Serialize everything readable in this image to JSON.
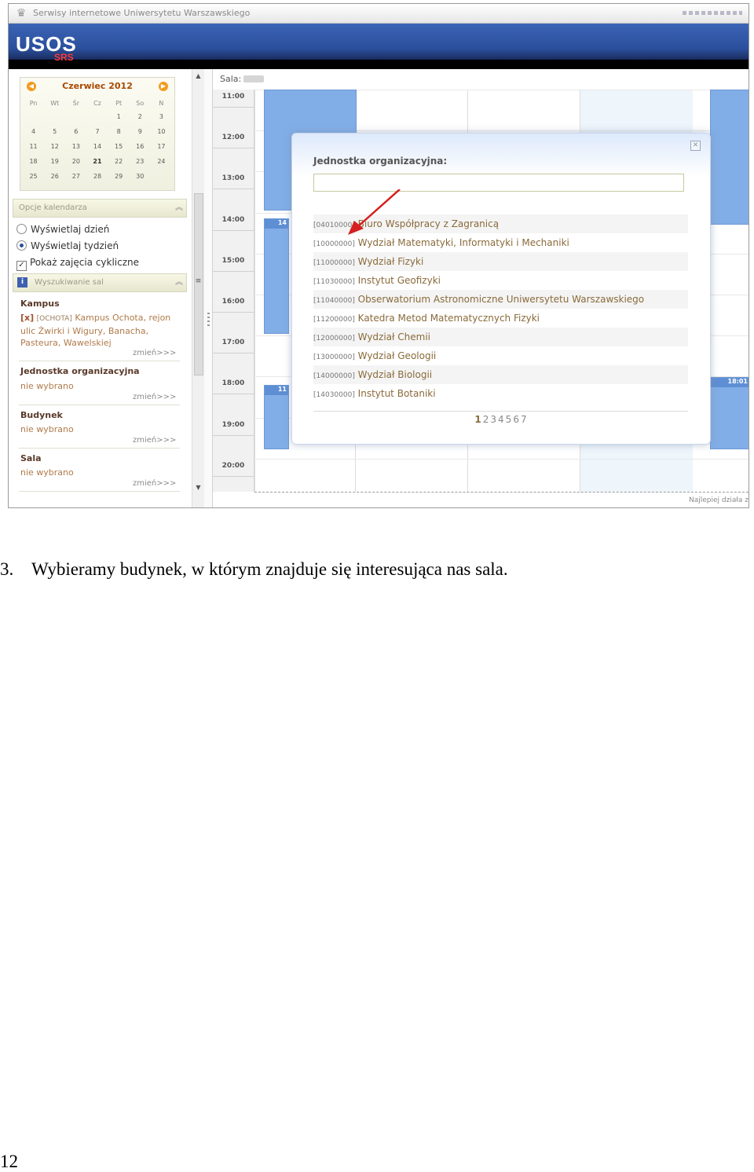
{
  "window": {
    "title": "Serwisy internetowe Uniwersytetu Warszawskiego"
  },
  "logo": {
    "main": "USOS",
    "sub": "SRS"
  },
  "calendar": {
    "month_label": "Czerwiec 2012",
    "weekdays": [
      "Pn",
      "Wt",
      "Śr",
      "Cz",
      "Pt",
      "So",
      "N"
    ],
    "weeks": [
      [
        "",
        "",
        "",
        "",
        "1",
        "2",
        "3"
      ],
      [
        "4",
        "5",
        "6",
        "7",
        "8",
        "9",
        "10"
      ],
      [
        "11",
        "12",
        "13",
        "14",
        "15",
        "16",
        "17"
      ],
      [
        "18",
        "19",
        "20",
        "21",
        "22",
        "23",
        "24"
      ],
      [
        "25",
        "26",
        "27",
        "28",
        "29",
        "30",
        ""
      ]
    ],
    "today": "21"
  },
  "options_panel": {
    "title": "Opcje kalendarza",
    "show_day": "Wyświetlaj dzień",
    "show_week": "Wyświetlaj tydzień",
    "show_cyclic": "Pokaż zajęcia cykliczne"
  },
  "search_panel": {
    "title": "Wyszukiwanie sal",
    "campus_label": "Kampus",
    "campus_remove": "[x]",
    "campus_code": "[OCHOTA]",
    "campus_value": "Kampus Ochota, rejon ulic Żwirki i Wigury, Banacha, Pasteura, Wawelskiej",
    "unit_label": "Jednostka organizacyjna",
    "unit_value": "nie wybrano",
    "building_label": "Budynek",
    "building_value": "nie wybrano",
    "room_label": "Sala",
    "room_value": "nie wybrano",
    "change": "zmień>>>"
  },
  "main": {
    "sala_label": "Sala:",
    "hours": [
      "11:00",
      "12:00",
      "13:00",
      "14:00",
      "15:00",
      "16:00",
      "17:00",
      "18:00",
      "19:00",
      "20:00"
    ],
    "event_labels": [
      "14",
      "11",
      "18:01"
    ],
    "footer_note": "Najlepiej działa z"
  },
  "modal": {
    "title": "Jednostka organizacyjna:",
    "close": "✕",
    "input_value": "",
    "items": [
      {
        "code": "[04010000]",
        "name": "Biuro Współpracy z Zagranicą"
      },
      {
        "code": "[10000000]",
        "name": "Wydział Matematyki, Informatyki i Mechaniki"
      },
      {
        "code": "[11000000]",
        "name": "Wydział Fizyki"
      },
      {
        "code": "[11030000]",
        "name": "Instytut Geofizyki"
      },
      {
        "code": "[11040000]",
        "name": "Obserwatorium Astronomiczne Uniwersytetu Warszawskiego"
      },
      {
        "code": "[11200000]",
        "name": "Katedra Metod Matematycznych Fizyki"
      },
      {
        "code": "[12000000]",
        "name": "Wydział Chemii"
      },
      {
        "code": "[13000000]",
        "name": "Wydział Geologii"
      },
      {
        "code": "[14000000]",
        "name": "Wydział Biologii"
      },
      {
        "code": "[14030000]",
        "name": "Instytut Botaniki"
      }
    ],
    "pages": [
      "1",
      "2",
      "3",
      "4",
      "5",
      "6",
      "7"
    ],
    "current_page": "1"
  },
  "caption": {
    "number": "3.",
    "text": "Wybieramy budynek, w którym znajduje się interesująca nas sala."
  },
  "page_number": "12",
  "colors": {
    "brand_blue": "#2b4f9c",
    "logo_red": "#ff3a3a",
    "link_brown": "#8a6a3a",
    "arrow_red": "#d42020"
  }
}
